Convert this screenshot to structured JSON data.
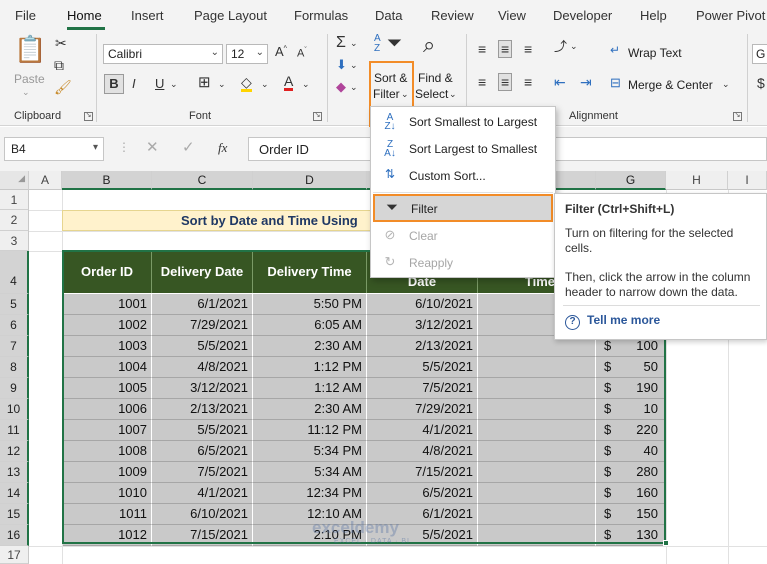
{
  "menu": {
    "tabs": [
      "File",
      "Home",
      "Insert",
      "Page Layout",
      "Formulas",
      "Data",
      "Review",
      "View",
      "Developer",
      "Help",
      "Power Pivot"
    ],
    "active": "Home"
  },
  "ribbon": {
    "clipboard": {
      "paste_label": "Paste",
      "group_label": "Clipboard"
    },
    "font": {
      "font_name": "Calibri",
      "font_size": "12",
      "bold": "B",
      "italic": "I",
      "underline": "U",
      "group_label": "Font"
    },
    "editing": {
      "sigma": "Σ",
      "sort_filter_line1": "Sort &",
      "sort_filter_line2": "Filter",
      "find_select_line1": "Find &",
      "find_select_line2": "Select"
    },
    "alignment": {
      "wrap_text": "Wrap Text",
      "merge_center": "Merge & Center",
      "group_label": "Alignment"
    },
    "number_peek": "G"
  },
  "formula_bar": {
    "name_box": "B4",
    "fx": "fx",
    "content": "Order ID"
  },
  "grid": {
    "columns": [
      "A",
      "B",
      "C",
      "D",
      "E",
      "F",
      "G",
      "H",
      "I"
    ],
    "rows": [
      "1",
      "2",
      "3",
      "4",
      "5",
      "6",
      "7",
      "8",
      "9",
      "10",
      "11",
      "12",
      "13",
      "14",
      "15",
      "16",
      "17"
    ],
    "title": "Sort by Date and Time Using"
  },
  "table": {
    "headers": [
      "Order ID",
      "Delivery Date",
      "Delivery Time",
      "Date",
      "Time"
    ],
    "rows": [
      {
        "id": "1001",
        "date": "6/1/2021",
        "time": "5:50 PM",
        "date2": "6/10/2021",
        "g": ""
      },
      {
        "id": "1002",
        "date": "7/29/2021",
        "time": "6:05 AM",
        "date2": "3/12/2021",
        "g": ""
      },
      {
        "id": "1003",
        "date": "5/5/2021",
        "time": "2:30 AM",
        "date2": "2/13/2021",
        "g": "100"
      },
      {
        "id": "1004",
        "date": "4/8/2021",
        "time": "1:12 PM",
        "date2": "5/5/2021",
        "g": "50"
      },
      {
        "id": "1005",
        "date": "3/12/2021",
        "time": "1:12 AM",
        "date2": "7/5/2021",
        "g": "190"
      },
      {
        "id": "1006",
        "date": "2/13/2021",
        "time": "2:30 AM",
        "date2": "7/29/2021",
        "g": "10"
      },
      {
        "id": "1007",
        "date": "5/5/2021",
        "time": "11:12 PM",
        "date2": "4/1/2021",
        "g": "220"
      },
      {
        "id": "1008",
        "date": "6/5/2021",
        "time": "5:34 PM",
        "date2": "4/8/2021",
        "g": "40"
      },
      {
        "id": "1009",
        "date": "7/5/2021",
        "time": "5:34 AM",
        "date2": "7/15/2021",
        "g": "280"
      },
      {
        "id": "1010",
        "date": "4/1/2021",
        "time": "12:34 PM",
        "date2": "6/5/2021",
        "g": "160"
      },
      {
        "id": "1011",
        "date": "6/10/2021",
        "time": "12:10 AM",
        "date2": "6/1/2021",
        "g": "150"
      },
      {
        "id": "1012",
        "date": "7/15/2021",
        "time": "2:10 PM",
        "date2": "5/5/2021",
        "g": "130"
      }
    ],
    "currency_symbol": "$"
  },
  "sort_menu": {
    "items": [
      {
        "label": "Sort Smallest to Largest",
        "icon": "sort-ascending-icon",
        "enabled": true
      },
      {
        "label": "Sort Largest to Smallest",
        "icon": "sort-descending-icon",
        "enabled": true
      },
      {
        "label": "Custom Sort...",
        "icon": "custom-sort-icon",
        "enabled": true
      },
      {
        "label": "Filter",
        "icon": "filter-icon",
        "enabled": true,
        "highlighted": true
      },
      {
        "label": "Clear",
        "icon": "clear-filter-icon",
        "enabled": false
      },
      {
        "label": "Reapply",
        "icon": "reapply-icon",
        "enabled": false
      }
    ]
  },
  "tooltip": {
    "title": "Filter (Ctrl+Shift+L)",
    "p1": "Turn on filtering for the selected cells.",
    "p2": "Then, click the arrow in the column header to narrow down the data.",
    "more": "Tell me more"
  },
  "watermark": {
    "brand": "exceldemy",
    "tagline": "EXCEL · DATA · BI"
  },
  "colors": {
    "accent": "#217346",
    "highlight": "#f28c28",
    "header_fill": "#375623",
    "title_fill": "#fff2cc"
  }
}
